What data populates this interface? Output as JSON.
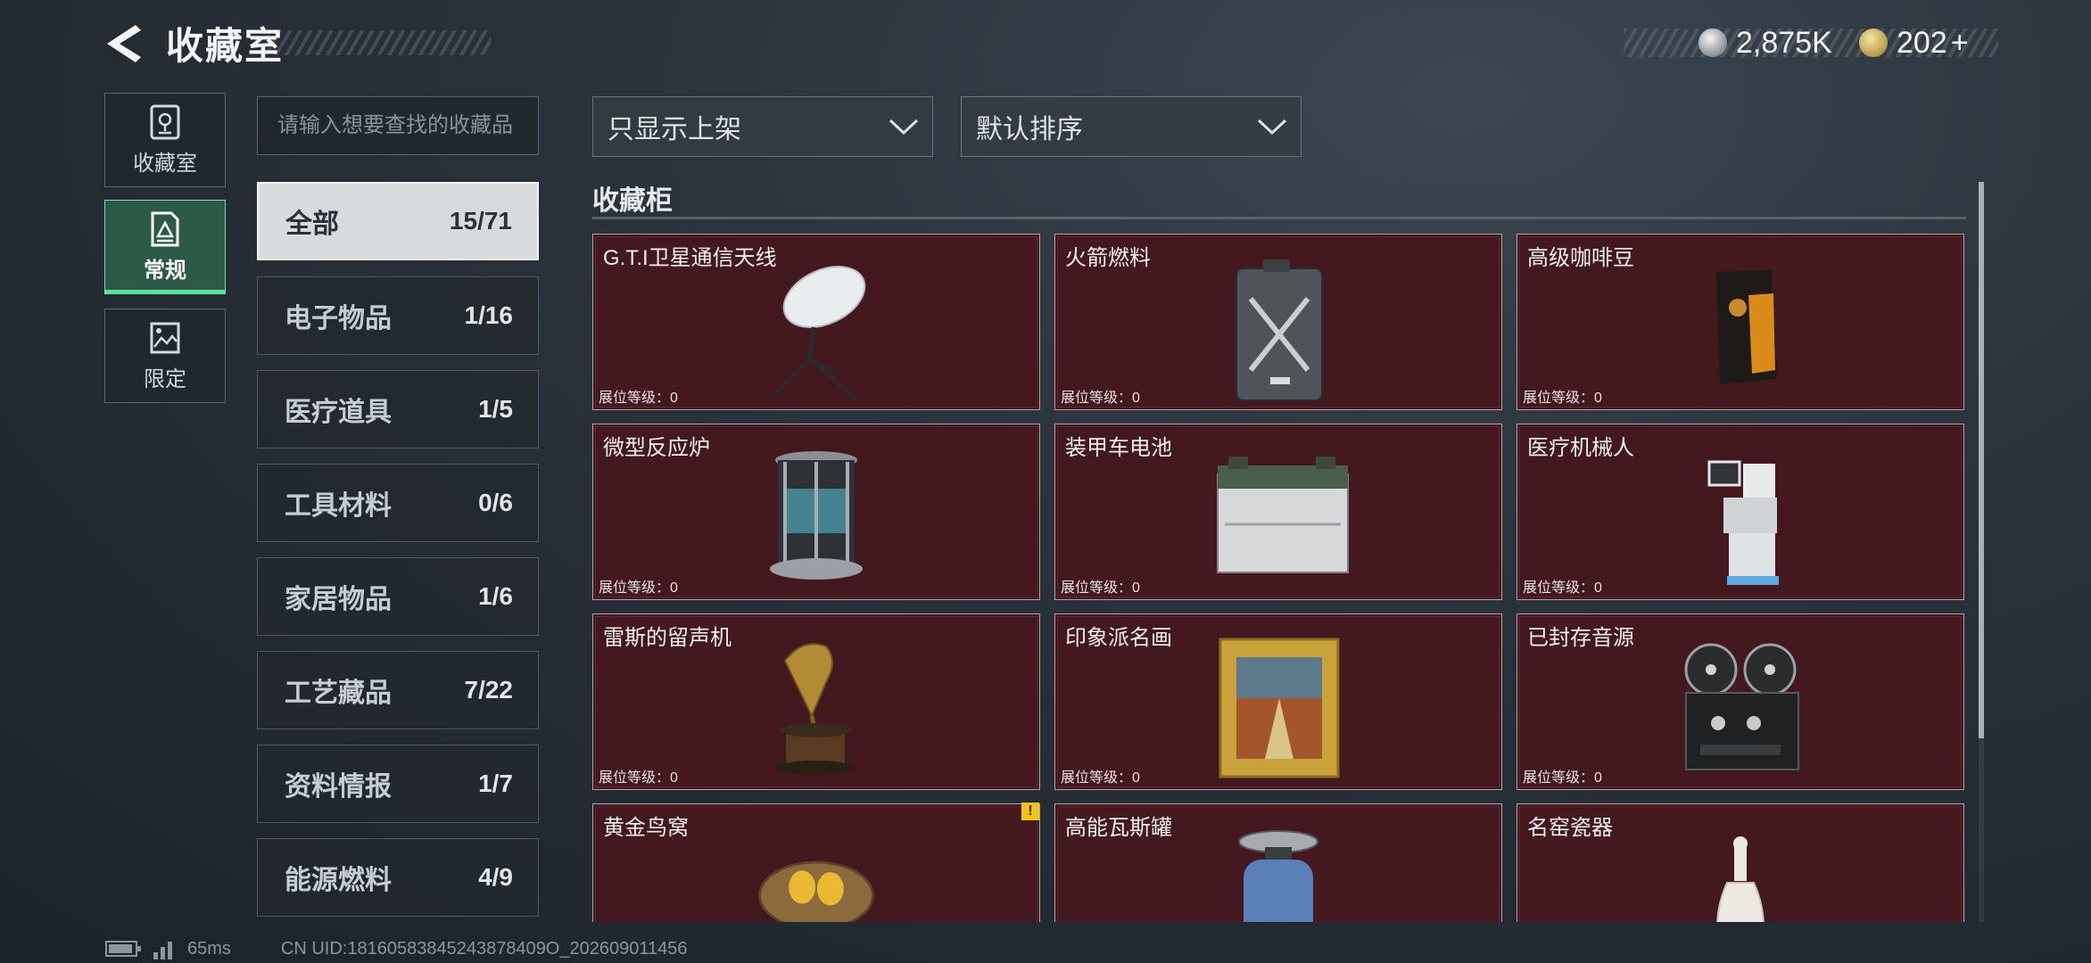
{
  "header": {
    "title": "收藏室",
    "currency_1": {
      "icon": "silver-coin-icon",
      "value": "2,875K"
    },
    "currency_2": {
      "icon": "gold-coin-icon",
      "value": "202",
      "plus": "+"
    }
  },
  "nav": [
    {
      "label": "收藏室",
      "icon": "vault-icon",
      "active": false
    },
    {
      "label": "常规",
      "icon": "document-triangle-icon",
      "active": true
    },
    {
      "label": "限定",
      "icon": "picture-icon",
      "active": false
    }
  ],
  "search": {
    "placeholder": "请输入想要查找的收藏品",
    "value": ""
  },
  "filters": {
    "display": "只显示上架",
    "sort": "默认排序"
  },
  "categories": [
    {
      "name": "全部",
      "count": "15/71",
      "active": true
    },
    {
      "name": "电子物品",
      "count": "1/16"
    },
    {
      "name": "医疗道具",
      "count": "1/5"
    },
    {
      "name": "工具材料",
      "count": "0/6"
    },
    {
      "name": "家居物品",
      "count": "1/6"
    },
    {
      "name": "工艺藏品",
      "count": "7/22"
    },
    {
      "name": "资料情报",
      "count": "1/7"
    },
    {
      "name": "能源燃料",
      "count": "4/9"
    }
  ],
  "section": {
    "title": "收藏柜"
  },
  "items": [
    {
      "name": "G.T.I卫星通信天线",
      "level": "展位等级：0",
      "icon": "satellite-dish-icon"
    },
    {
      "name": "火箭燃料",
      "level": "展位等级：0",
      "icon": "fuel-can-icon"
    },
    {
      "name": "高级咖啡豆",
      "level": "展位等级：0",
      "icon": "coffee-bag-icon"
    },
    {
      "name": "微型反应炉",
      "level": "展位等级：0",
      "icon": "reactor-icon"
    },
    {
      "name": "装甲车电池",
      "level": "展位等级：0",
      "icon": "battery-icon"
    },
    {
      "name": "医疗机械人",
      "level": "展位等级：0",
      "icon": "medical-robot-icon"
    },
    {
      "name": "雷斯的留声机",
      "level": "展位等级：0",
      "icon": "gramophone-icon"
    },
    {
      "name": "印象派名画",
      "level": "展位等级：0",
      "icon": "framed-painting-icon"
    },
    {
      "name": "已封存音源",
      "level": "展位等级：0",
      "icon": "reel-to-reel-icon"
    },
    {
      "name": "黄金鸟窝",
      "level": "",
      "icon": "golden-nest-icon",
      "warning": "!"
    },
    {
      "name": "高能瓦斯罐",
      "level": "",
      "icon": "gas-canister-icon"
    },
    {
      "name": "名窑瓷器",
      "level": "",
      "icon": "porcelain-vase-icon"
    }
  ],
  "footer": {
    "ping": "65ms",
    "uid": "CN UID:18160583845243878409O_202609011456"
  }
}
